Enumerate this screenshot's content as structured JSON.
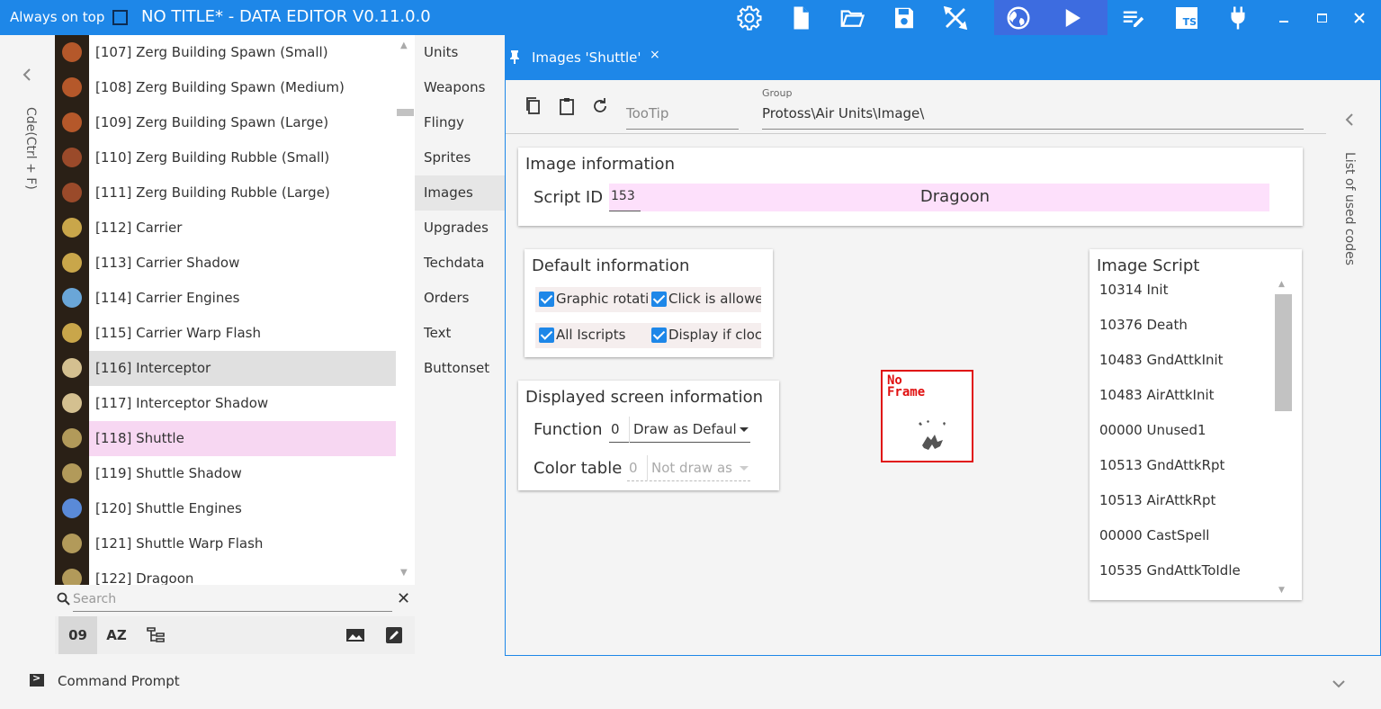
{
  "titlebar": {
    "always_on_top": "Always on top",
    "title": "NO TITLE* - DATA EDITOR V0.11.0.0",
    "icons": [
      "gear-icon",
      "file-icon",
      "folder-open-icon",
      "save-icon",
      "tools-icon",
      "globe-icon",
      "play-icon",
      "edit-list-icon",
      "ts-icon",
      "plug-icon"
    ],
    "ts_text": "TS"
  },
  "left_rail": {
    "label": "Cde(Ctrl + F)"
  },
  "item_list": [
    {
      "text": "[107]  Zerg Building Spawn (Small)",
      "thumb_color": "#b5582a"
    },
    {
      "text": "[108]  Zerg Building Spawn (Medium)",
      "thumb_color": "#b5582a"
    },
    {
      "text": "[109]  Zerg Building Spawn (Large)",
      "thumb_color": "#b5582a"
    },
    {
      "text": "[110]  Zerg Building Rubble (Small)",
      "thumb_color": "#9a4a2a"
    },
    {
      "text": "[111]  Zerg Building Rubble (Large)",
      "thumb_color": "#9a4a2a"
    },
    {
      "text": "[112]  Carrier",
      "thumb_color": "#c9a64a"
    },
    {
      "text": "[113]  Carrier Shadow",
      "thumb_color": "#c9a64a"
    },
    {
      "text": "[114]  Carrier Engines",
      "thumb_color": "#6aa6d8"
    },
    {
      "text": "[115]  Carrier Warp Flash",
      "thumb_color": "#c9a64a"
    },
    {
      "text": "[116]  Interceptor",
      "thumb_color": "#d4c090"
    },
    {
      "text": "[117]  Interceptor Shadow",
      "thumb_color": "#d4c090"
    },
    {
      "text": "[118]  Shuttle",
      "thumb_color": "#b29a5a"
    },
    {
      "text": "[119]  Shuttle Shadow",
      "thumb_color": "#b29a5a"
    },
    {
      "text": "[120]  Shuttle Engines",
      "thumb_color": "#5a8ad8"
    },
    {
      "text": "[121]  Shuttle Warp Flash",
      "thumb_color": "#b29a5a"
    },
    {
      "text": "[122]  Dragoon",
      "thumb_color": "#b29a5a"
    }
  ],
  "search": {
    "placeholder": "Search",
    "clear": "✕"
  },
  "tools": {
    "sort_number": "09",
    "sort_alpha": "AZ"
  },
  "categories": [
    "Units",
    "Weapons",
    "Flingy",
    "Sprites",
    "Images",
    "Upgrades",
    "Techdata",
    "Orders",
    "Text",
    "Buttonset"
  ],
  "active_category": "Images",
  "tab": {
    "label": "Images 'Shuttle'",
    "close": "×"
  },
  "toolbar": {
    "tooltip": "TooTip",
    "group_label": "Group",
    "group_value": "Protoss\\Air Units\\Image\\"
  },
  "image_info": {
    "title": "Image information",
    "script_id_label": "Script ID",
    "script_id": "153",
    "script_name": "Dragoon"
  },
  "default_info": {
    "title": "Default information",
    "checkboxes": [
      {
        "label": "Graphic rotatio",
        "checked": true
      },
      {
        "label": "Click is allowed",
        "checked": true
      },
      {
        "label": "All Iscripts",
        "checked": true
      },
      {
        "label": "Display if clock",
        "checked": true
      }
    ]
  },
  "screen_info": {
    "title": "Displayed screen information",
    "function_label": "Function",
    "function_num": "0",
    "function_value": "Draw as Defaul",
    "color_table_label": "Color table",
    "color_num": "0",
    "color_value": "Not draw as"
  },
  "preview": {
    "text_line1": "No",
    "text_line2": "Frame"
  },
  "image_script": {
    "title": "Image Script",
    "items": [
      "10314 Init",
      "10376 Death",
      "10483 GndAttkInit",
      "10483 AirAttkInit",
      "00000 Unused1",
      "10513 GndAttkRpt",
      "10513 AirAttkRpt",
      "00000 CastSpell",
      "10535 GndAttkToIdle"
    ]
  },
  "right_rail": {
    "label": "List of used codes"
  },
  "bottom": {
    "command_prompt": "Command Prompt"
  },
  "colors": {
    "accent": "#1e87e8",
    "selected_pink": "#f7d7f2",
    "selected_gray": "#e0e0e0",
    "field_pink": "#fde0fb",
    "preview_red": "#e01010"
  }
}
